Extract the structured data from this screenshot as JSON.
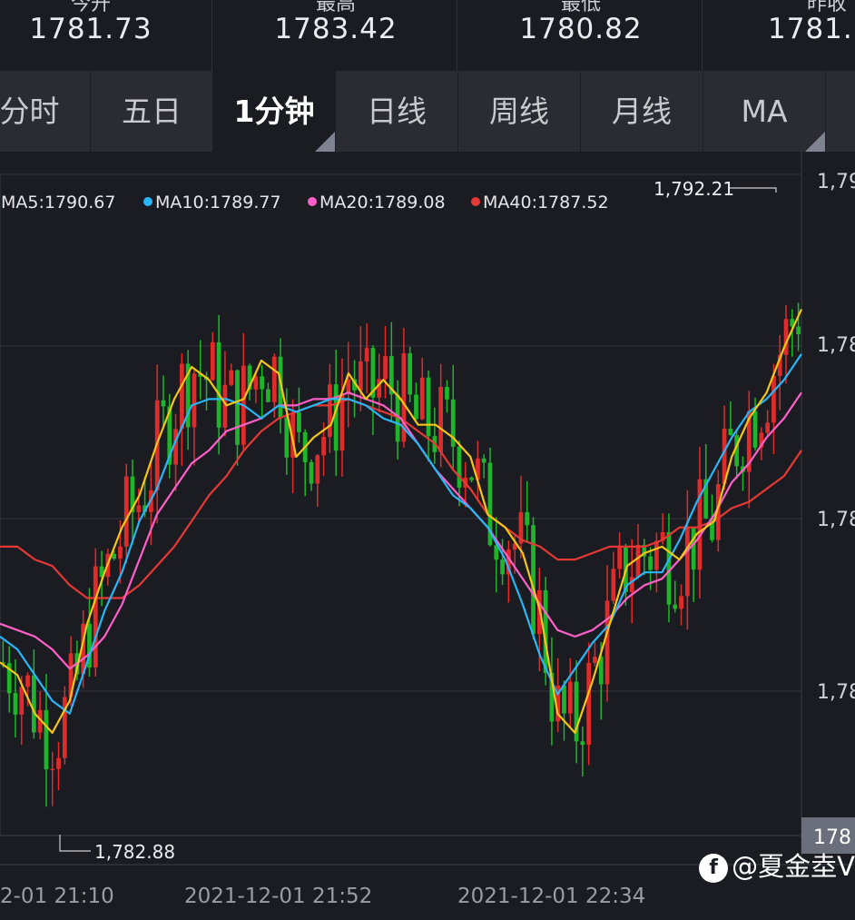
{
  "quotes": [
    {
      "label": "今开",
      "value": "1781.73"
    },
    {
      "label": "最高",
      "value": "1783.42"
    },
    {
      "label": "最低",
      "value": "1780.82"
    },
    {
      "label": "昨收",
      "value": "1781."
    }
  ],
  "tabs": [
    {
      "label": "分时",
      "active": false
    },
    {
      "label": "五日",
      "active": false
    },
    {
      "label": "1分钟",
      "active": true
    },
    {
      "label": "日线",
      "active": false
    },
    {
      "label": "周线",
      "active": false
    },
    {
      "label": "月线",
      "active": false
    },
    {
      "label": "MA",
      "active": false
    }
  ],
  "legend": [
    {
      "text": "MA5:1790.67",
      "color": "#f5c518"
    },
    {
      "text": "MA10:1789.77",
      "color": "#29b6f6"
    },
    {
      "text": "MA20:1789.08",
      "color": "#ff5fc8"
    },
    {
      "text": "MA40:1787.52",
      "color": "#e53935"
    }
  ],
  "chart_data": {
    "type": "candlestick",
    "series_colors": {
      "up": "#e02b2b",
      "down": "#1fb52b"
    },
    "y_labels": [
      "1,79",
      "1,78",
      "1,78",
      "1,78"
    ],
    "current_price_label": "178",
    "max_label": "1,792.21",
    "min_label": "1,782.88",
    "x_labels": [
      "2-01 21:10",
      "2021-12-01 21:52",
      "2021-12-01 22:34"
    ],
    "moving_averages": [
      {
        "name": "MA5",
        "color": "#f5c518",
        "values": [
          1785.2,
          1785.0,
          1784.4,
          1784.1,
          1784.6,
          1785.8,
          1786.6,
          1787.3,
          1787.8,
          1788.6,
          1789.3,
          1789.8,
          1789.6,
          1789.2,
          1789.3,
          1789.9,
          1789.7,
          1788.4,
          1788.7,
          1788.9,
          1789.7,
          1789.3,
          1789.6,
          1789.3,
          1788.9,
          1788.9,
          1788.7,
          1788.4,
          1787.5,
          1787.3,
          1786.9,
          1786.0,
          1784.4,
          1784.1,
          1784.9,
          1785.8,
          1786.7,
          1786.9,
          1787.0,
          1786.8,
          1787.2,
          1787.4,
          1788.4,
          1789.0,
          1789.4,
          1790.1,
          1790.7
        ]
      },
      {
        "name": "MA10",
        "color": "#29b6f6",
        "values": [
          1785.6,
          1785.4,
          1785.0,
          1784.6,
          1784.4,
          1785.2,
          1786.0,
          1786.6,
          1787.4,
          1787.9,
          1788.6,
          1789.2,
          1789.3,
          1789.3,
          1789.2,
          1789.0,
          1789.2,
          1789.1,
          1789.2,
          1789.3,
          1789.3,
          1789.2,
          1789.0,
          1788.9,
          1788.6,
          1788.2,
          1787.8,
          1787.6,
          1787.3,
          1786.8,
          1786.1,
          1785.3,
          1784.7,
          1785.1,
          1785.5,
          1785.8,
          1786.4,
          1786.6,
          1786.6,
          1787.1,
          1787.7,
          1788.2,
          1788.7,
          1789.1,
          1789.3,
          1789.6,
          1790.0
        ]
      },
      {
        "name": "MA20",
        "color": "#ff5fc8",
        "values": [
          1785.8,
          1785.7,
          1785.6,
          1785.4,
          1785.1,
          1785.3,
          1785.6,
          1786.1,
          1786.8,
          1787.5,
          1787.9,
          1788.3,
          1788.5,
          1788.8,
          1788.9,
          1789.0,
          1789.2,
          1789.2,
          1789.3,
          1789.3,
          1789.4,
          1789.3,
          1789.2,
          1789.0,
          1788.6,
          1788.2,
          1787.9,
          1787.6,
          1787.3,
          1786.9,
          1786.5,
          1786.1,
          1785.7,
          1785.6,
          1785.7,
          1785.9,
          1786.2,
          1786.4,
          1786.5,
          1786.8,
          1787.1,
          1787.5,
          1788.0,
          1788.3,
          1788.7,
          1789.0,
          1789.4
        ]
      },
      {
        "name": "MA40",
        "color": "#e53935",
        "values": [
          1787.0,
          1787.0,
          1786.8,
          1786.7,
          1786.4,
          1786.2,
          1786.2,
          1786.2,
          1786.4,
          1786.7,
          1787.0,
          1787.4,
          1787.8,
          1788.1,
          1788.5,
          1788.8,
          1789.0,
          1789.1,
          1789.2,
          1789.2,
          1789.3,
          1789.2,
          1789.1,
          1789.0,
          1788.8,
          1788.6,
          1788.2,
          1787.9,
          1787.5,
          1787.3,
          1787.1,
          1787.0,
          1786.8,
          1786.8,
          1786.9,
          1787.0,
          1787.0,
          1787.0,
          1787.1,
          1787.3,
          1787.3,
          1787.4,
          1787.6,
          1787.7,
          1787.9,
          1788.1,
          1788.5
        ]
      }
    ]
  },
  "watermark": "@夏金坴V"
}
